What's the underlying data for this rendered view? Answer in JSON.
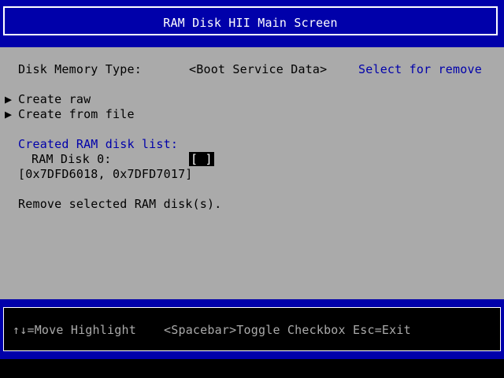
{
  "title": "RAM Disk HII Main Screen",
  "disk_memory_type": {
    "label": "Disk Memory Type:",
    "value": "<Boot Service Data>",
    "help": "Select for remove"
  },
  "menu": {
    "marker": "▶",
    "create_raw": "Create raw",
    "create_from_file": "Create from file"
  },
  "ram_disk_list": {
    "heading": "Created RAM disk list:",
    "item_label": "RAM Disk 0:",
    "checkbox": "[ ]",
    "address": "[0x7DFD6018, 0x7DFD7017]"
  },
  "remove_label": "Remove selected RAM disk(s).",
  "footer": {
    "move_highlight": "↑↓=Move Highlight",
    "toggle_exit": "<Spacebar>Toggle Checkbox Esc=Exit"
  }
}
